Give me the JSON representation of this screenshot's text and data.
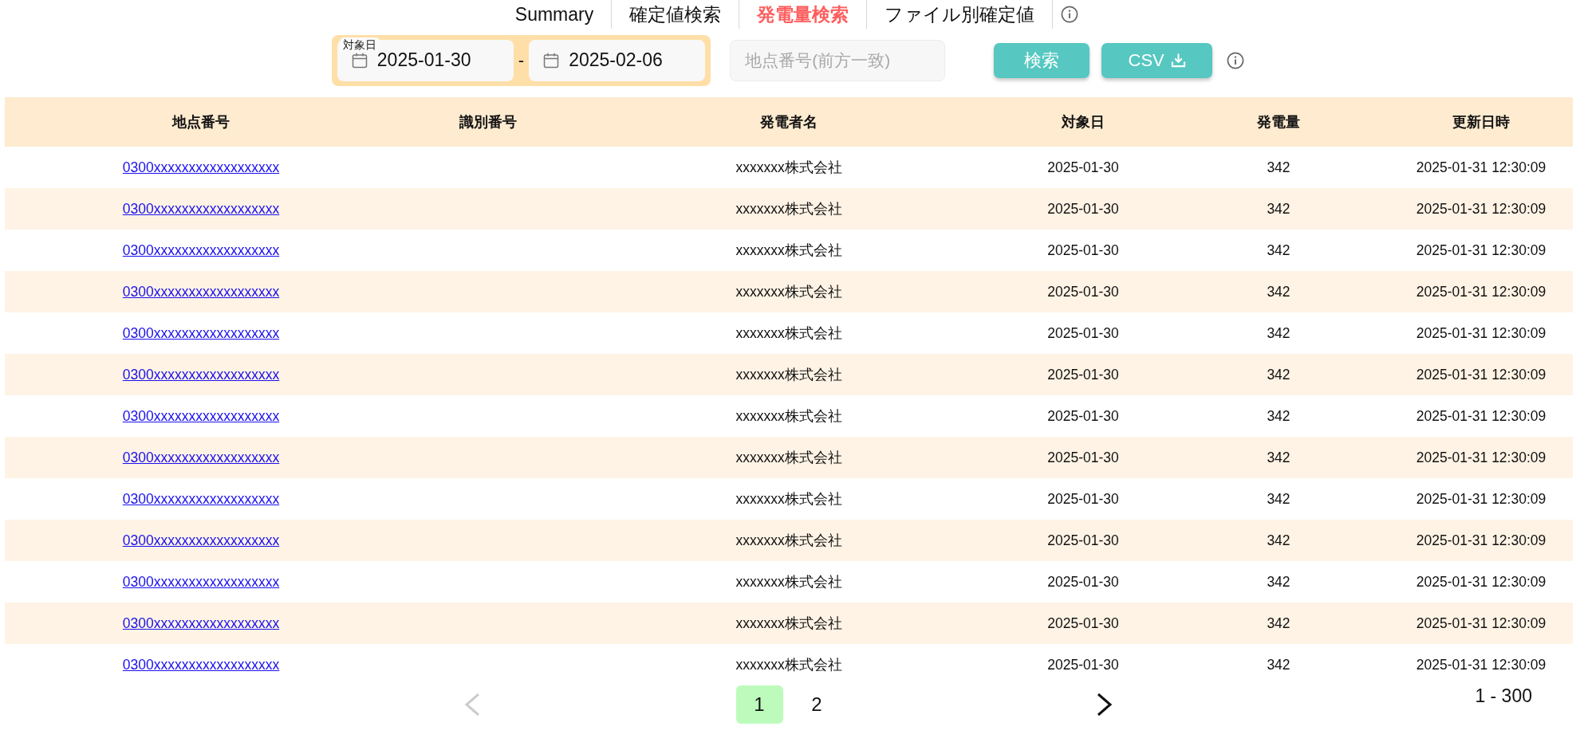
{
  "nav_tabs": [
    {
      "label": "Summary",
      "selected": false
    },
    {
      "label": "確定値検索",
      "selected": false
    },
    {
      "label": "発電量検索",
      "selected": true
    },
    {
      "label": "ファイル別確定値",
      "selected": false
    }
  ],
  "filters": {
    "date_range": {
      "label": "対象日",
      "start": "2025-01-30",
      "separator": "-",
      "end": "2025-02-06"
    },
    "point_number": {
      "placeholder": "地点番号(前方一致)"
    },
    "buttons": [
      {
        "label": "検索",
        "kind": "search"
      },
      {
        "label": "CSV",
        "kind": "download"
      }
    ]
  },
  "table": {
    "columns": [
      "地点番号",
      "識別番号",
      "発電者名",
      "対象日",
      "発電量",
      "更新日時"
    ],
    "rows": [
      {
        "point_number": "0300xxxxxxxxxxxxxxxxxx",
        "generator_name": "xxxxxxx株式会社",
        "target_date": "2025-01-30",
        "amount": "342",
        "updated_at": "2025-01-31 12:30:09"
      },
      {
        "point_number": "0300xxxxxxxxxxxxxxxxxx",
        "generator_name": "xxxxxxx株式会社",
        "target_date": "2025-01-30",
        "amount": "342",
        "updated_at": "2025-01-31 12:30:09"
      },
      {
        "point_number": "0300xxxxxxxxxxxxxxxxxx",
        "generator_name": "xxxxxxx株式会社",
        "target_date": "2025-01-30",
        "amount": "342",
        "updated_at": "2025-01-31 12:30:09"
      },
      {
        "point_number": "0300xxxxxxxxxxxxxxxxxx",
        "generator_name": "xxxxxxx株式会社",
        "target_date": "2025-01-30",
        "amount": "342",
        "updated_at": "2025-01-31 12:30:09"
      },
      {
        "point_number": "0300xxxxxxxxxxxxxxxxxx",
        "generator_name": "xxxxxxx株式会社",
        "target_date": "2025-01-30",
        "amount": "342",
        "updated_at": "2025-01-31 12:30:09"
      },
      {
        "point_number": "0300xxxxxxxxxxxxxxxxxx",
        "generator_name": "xxxxxxx株式会社",
        "target_date": "2025-01-30",
        "amount": "342",
        "updated_at": "2025-01-31 12:30:09"
      },
      {
        "point_number": "0300xxxxxxxxxxxxxxxxxx",
        "generator_name": "xxxxxxx株式会社",
        "target_date": "2025-01-30",
        "amount": "342",
        "updated_at": "2025-01-31 12:30:09"
      },
      {
        "point_number": "0300xxxxxxxxxxxxxxxxxx",
        "generator_name": "xxxxxxx株式会社",
        "target_date": "2025-01-30",
        "amount": "342",
        "updated_at": "2025-01-31 12:30:09"
      },
      {
        "point_number": "0300xxxxxxxxxxxxxxxxxx",
        "generator_name": "xxxxxxx株式会社",
        "target_date": "2025-01-30",
        "amount": "342",
        "updated_at": "2025-01-31 12:30:09"
      },
      {
        "point_number": "0300xxxxxxxxxxxxxxxxxx",
        "generator_name": "xxxxxxx株式会社",
        "target_date": "2025-01-30",
        "amount": "342",
        "updated_at": "2025-01-31 12:30:09"
      },
      {
        "point_number": "0300xxxxxxxxxxxxxxxxxx",
        "generator_name": "xxxxxxx株式会社",
        "target_date": "2025-01-30",
        "amount": "342",
        "updated_at": "2025-01-31 12:30:09"
      },
      {
        "point_number": "0300xxxxxxxxxxxxxxxxxx",
        "generator_name": "xxxxxxx株式会社",
        "target_date": "2025-01-30",
        "amount": "342",
        "updated_at": "2025-01-31 12:30:09"
      },
      {
        "point_number": "0300xxxxxxxxxxxxxxxxxx",
        "generator_name": "xxxxxxx株式会社",
        "target_date": "2025-01-30",
        "amount": "342",
        "updated_at": "2025-01-31 12:30:09"
      }
    ]
  },
  "pagination": {
    "prev_disabled": true,
    "pages": [
      {
        "label": "1",
        "selected": true
      },
      {
        "label": "2",
        "selected": false
      }
    ],
    "next_disabled": false,
    "range": "1 - 300"
  }
}
